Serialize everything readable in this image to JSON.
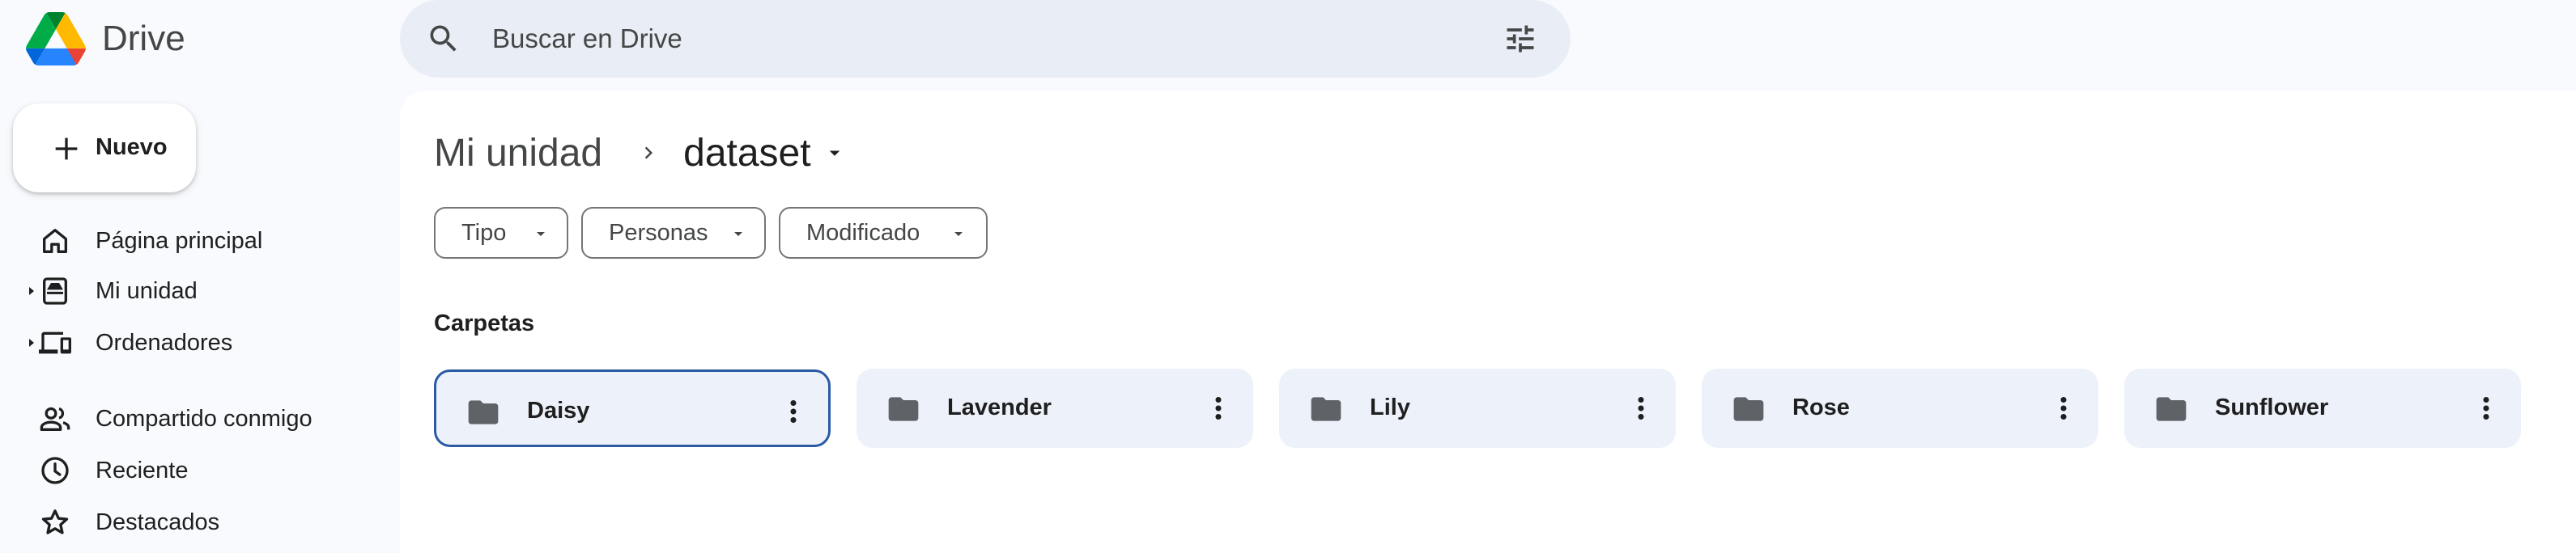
{
  "app": {
    "name": "Drive",
    "logo_icon": "google-drive-logo"
  },
  "search": {
    "placeholder": "Buscar en Drive",
    "value": "",
    "icon": "search-icon",
    "filter_icon": "tune-icon"
  },
  "sidebar": {
    "new_button": {
      "label": "Nuevo",
      "icon": "plus-icon"
    },
    "items": [
      {
        "label": "Página principal",
        "icon": "home-icon",
        "expandable": false
      },
      {
        "label": "Mi unidad",
        "icon": "my-drive-icon",
        "expandable": true
      },
      {
        "label": "Ordenadores",
        "icon": "computers-icon",
        "expandable": true
      },
      {
        "label": "Compartido conmigo",
        "icon": "people-icon",
        "expandable": false
      },
      {
        "label": "Reciente",
        "icon": "clock-icon",
        "expandable": false
      },
      {
        "label": "Destacados",
        "icon": "star-icon",
        "expandable": false
      }
    ]
  },
  "breadcrumb": {
    "root": "Mi unidad",
    "current": "dataset"
  },
  "filters": [
    {
      "label": "Tipo"
    },
    {
      "label": "Personas"
    },
    {
      "label": "Modificado"
    }
  ],
  "folders_section": {
    "title": "Carpetas",
    "items": [
      {
        "name": "Daisy",
        "selected": true
      },
      {
        "name": "Lavender",
        "selected": false
      },
      {
        "name": "Lily",
        "selected": false
      },
      {
        "name": "Rose",
        "selected": false
      },
      {
        "name": "Sunflower",
        "selected": false
      }
    ]
  },
  "colors": {
    "background": "#f8fafd",
    "search_bg": "#e9eef6",
    "folder_bg": "#edf2fa",
    "selected_border": "#2b5aa5",
    "text_primary": "#1f1f1f",
    "text_secondary": "#444746",
    "icon": "#444746"
  }
}
